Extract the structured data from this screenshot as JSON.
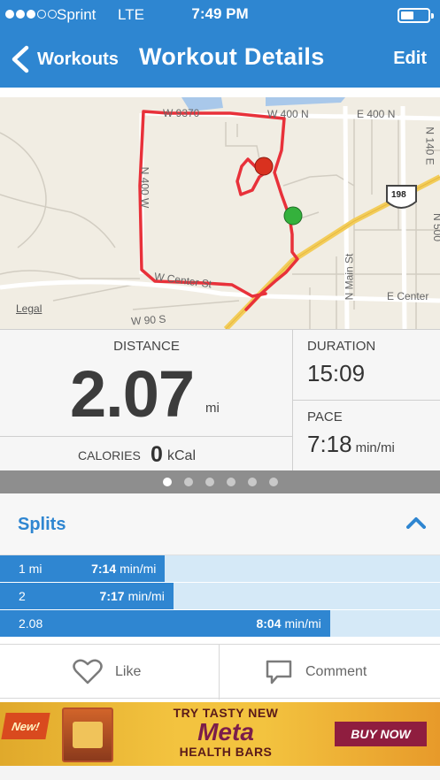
{
  "status_bar": {
    "carrier": "Sprint",
    "network": "LTE",
    "time": "7:49 PM"
  },
  "nav": {
    "back_label": "Workouts",
    "title": "Workout Details",
    "edit_label": "Edit"
  },
  "map": {
    "labels": {
      "w9370": "W 9370",
      "w400n": "W 400 N",
      "e400n": "E 400 N",
      "n140e": "N 140 E",
      "n400w": "N 400 W",
      "route198": "198",
      "wcenter": "W Center St",
      "nmain": "N Main St",
      "ecenter": "E Center",
      "w90s": "W 90 S",
      "n500": "N 500"
    },
    "legal": "Legal"
  },
  "stats": {
    "distance_label": "DISTANCE",
    "distance_value": "2.07",
    "distance_unit": "mi",
    "duration_label": "DURATION",
    "duration_value": "15:09",
    "pace_label": "PACE",
    "pace_value": "7:18",
    "pace_unit": "min/mi",
    "calories_label": "CALORIES",
    "calories_value": "0",
    "calories_unit": "kCal"
  },
  "pager": {
    "count": 6,
    "active_index": 0
  },
  "splits": {
    "title": "Splits",
    "rows": [
      {
        "label": "1 mi",
        "pace": "7:14",
        "unit": "min/mi",
        "fill_fraction": 0.375
      },
      {
        "label": "2",
        "pace": "7:17",
        "unit": "min/mi",
        "fill_fraction": 0.394
      },
      {
        "label": "2.08",
        "pace": "8:04",
        "unit": "min/mi",
        "fill_fraction": 0.75
      }
    ]
  },
  "actions": {
    "like_label": "Like",
    "comment_label": "Comment"
  },
  "ad": {
    "badge": "New!",
    "line1": "TRY TASTY NEW",
    "line2": "Meta",
    "line3": "HEALTH BARS",
    "cta": "BUY NOW"
  },
  "colors": {
    "primary": "#2e86d1",
    "route": "#e8313a",
    "split_bg": "#d5e9f7"
  }
}
